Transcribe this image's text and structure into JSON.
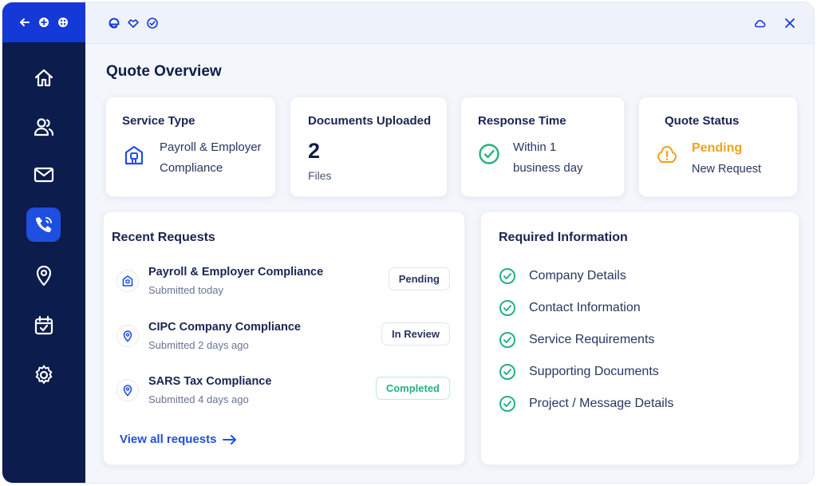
{
  "app": {
    "title": "Quote Overview"
  },
  "stats": {
    "service_type": {
      "label": "Service Type",
      "line1": "Payroll & Employer",
      "line2": "Compliance"
    },
    "documents": {
      "label": "Documents Uploaded",
      "value": "2",
      "unit": "Files"
    },
    "response": {
      "label": "Response Time",
      "line1": "Within 1",
      "line2": "business day"
    },
    "status": {
      "label": "Quote Status",
      "value": "Pending",
      "detail": "New Request",
      "accent": "#f0a21b"
    }
  },
  "recent": {
    "title": "Recent Requests",
    "items": [
      {
        "title": "Payroll & Employer Compliance",
        "sub": "Submitted today",
        "badge": "Pending",
        "icon": "building-icon"
      },
      {
        "title": "CIPC Company Compliance",
        "sub": "Submitted 2 days ago",
        "badge": "In Review",
        "icon": "location-pin-icon"
      },
      {
        "title": "SARS Tax Compliance",
        "sub": "Submitted 4 days ago",
        "badge": "Completed",
        "icon": "location-pin-icon"
      }
    ],
    "view_all": "View all requests"
  },
  "required": {
    "title": "Required Information",
    "items": [
      "Company Details",
      "Contact Information",
      "Service Requirements",
      "Supporting Documents",
      "Project / Message Details"
    ]
  },
  "sidebar": {
    "items": [
      "home-icon",
      "users-icon",
      "mail-icon",
      "phone-icon",
      "location-icon",
      "calendar-icon",
      "settings-icon"
    ],
    "active": "phone-icon"
  },
  "colors": {
    "brand": "#1539d6",
    "sidebar": "#0b1c4d",
    "success": "#27b27a",
    "warning": "#f0a21b"
  }
}
